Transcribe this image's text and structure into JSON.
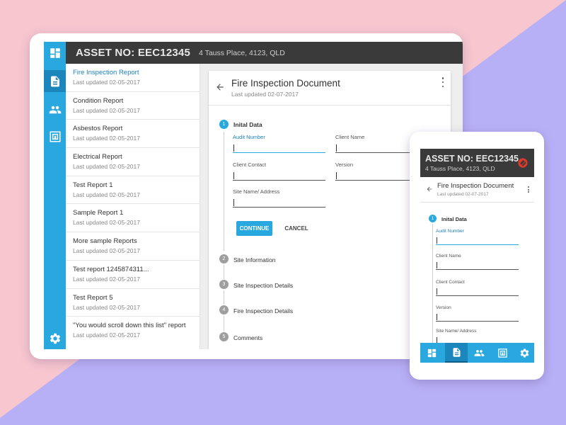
{
  "tablet": {
    "header": {
      "asset": "ASSET NO: EEC12345",
      "address": "4 Tauss Place, 4123, QLD"
    },
    "reports": [
      {
        "name": "Fire Inspection Report",
        "date": "Last updated 02-05-2017"
      },
      {
        "name": "Condition Report",
        "date": "Last updated 02-05-2017"
      },
      {
        "name": "Asbestos Report",
        "date": "Last updated 02-05-2017"
      },
      {
        "name": "Electrical Report",
        "date": "Last updated 02-05-2017"
      },
      {
        "name": "Test Report 1",
        "date": "Last updated 02-05-2017"
      },
      {
        "name": "Sample Report 1",
        "date": "Last updated 02-05-2017"
      },
      {
        "name": "More sample Reports",
        "date": "Last updated 02-05-2017"
      },
      {
        "name": "Test report 1245874311...",
        "date": "Last updated 02-05-2017"
      },
      {
        "name": "Test Report 5",
        "date": "Last updated 02-05-2017"
      },
      {
        "name": "\"You would scroll down this list\" report",
        "date": "Last updated 02-05-2017"
      }
    ],
    "document": {
      "title": "Fire Inspection Document",
      "subtitle": "Last updated 02-07-2017",
      "steps": [
        {
          "num": "1",
          "label": "Inital Data"
        },
        {
          "num": "2",
          "label": "Site Information"
        },
        {
          "num": "3",
          "label": "Site Inspection Details"
        },
        {
          "num": "4",
          "label": "Fire Inspection Details"
        },
        {
          "num": "5",
          "label": "Comments"
        }
      ],
      "fields": {
        "audit_number": "Audit Number",
        "client_name": "Client Name",
        "client_contact": "Client Contact",
        "version": "Version",
        "site_name": "Site Name/ Address"
      },
      "continue_label": "CONTINUE",
      "cancel_label": "CANCEL"
    }
  },
  "phone": {
    "header": {
      "asset": "ASSET NO: EEC12345",
      "address": "4 Tauss Place, 4123, QLD"
    },
    "document": {
      "title": "Fire Inspection Document",
      "subtitle": "Last updated 02-07-2017",
      "step": {
        "num": "1",
        "label": "Inital Data"
      },
      "fields": {
        "audit_number": "Audit Number",
        "client_name": "Client Name",
        "client_contact": "Client Contact",
        "version": "Version",
        "site_name": "Site Name/ Address"
      }
    }
  },
  "icons": {
    "dashboard": "dashboard-icon",
    "reports": "document-icon",
    "people": "people-icon",
    "tag": "tag-icon",
    "settings": "gear-icon",
    "brand": "brand-logo-icon"
  },
  "colors": {
    "accent": "#29a8e0",
    "accent_dark": "#1a86bb",
    "header": "#3a3a3a",
    "bg_pink": "#f7c6cf",
    "bg_purple": "#b8b0f7"
  }
}
